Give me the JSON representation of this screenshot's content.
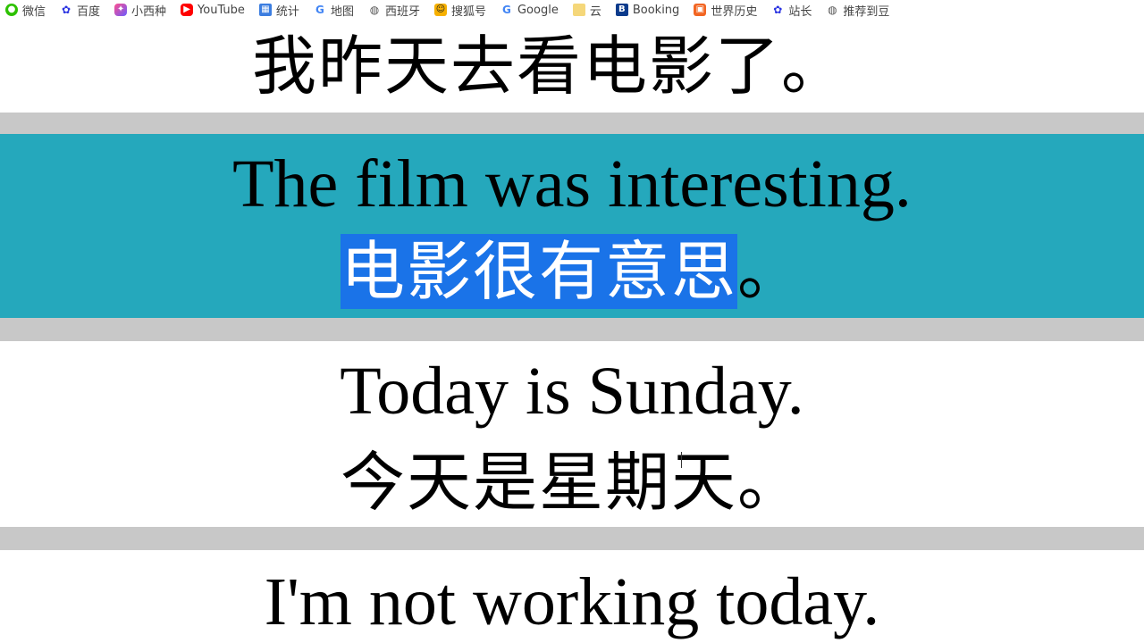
{
  "bookmarks": [
    {
      "label": "微信",
      "icon": "wechat-icon"
    },
    {
      "label": "百度",
      "icon": "baidu-icon"
    },
    {
      "label": "小西种",
      "icon": "xiaoxi-icon"
    },
    {
      "label": "YouTube",
      "icon": "youtube-icon"
    },
    {
      "label": "统计",
      "icon": "statistics-icon"
    },
    {
      "label": "地图",
      "icon": "google-icon"
    },
    {
      "label": "西班牙",
      "icon": "globe-icon"
    },
    {
      "label": "搜狐号",
      "icon": "sogou-icon"
    },
    {
      "label": "Google",
      "icon": "google-icon"
    },
    {
      "label": "云",
      "icon": "folder-icon"
    },
    {
      "label": "Booking",
      "icon": "booking-icon"
    },
    {
      "label": "世界历史",
      "icon": "history-icon"
    },
    {
      "label": "站长",
      "icon": "baidu-icon"
    },
    {
      "label": "推荐到豆",
      "icon": "globe-icon"
    }
  ],
  "slides": {
    "line1_zh": "我昨天去看电影了。",
    "line2_en": "The film was interesting.",
    "line2_zh_selected": "电影很有意思",
    "line2_zh_tail": "。",
    "line3_en": "Today is Sunday.",
    "line3_zh": "今天是星期天。",
    "line4_en": "I'm not working today."
  },
  "colors": {
    "teal_band": "#25a8bc",
    "grey_band": "#c8c8c8",
    "selection": "#1a73e8"
  }
}
